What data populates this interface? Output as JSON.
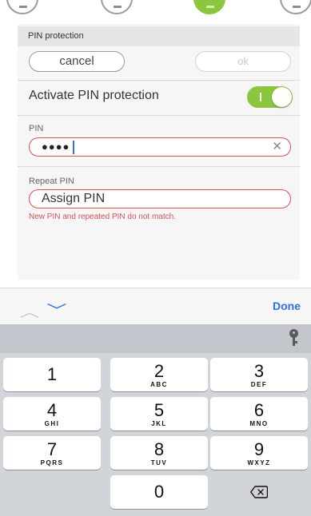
{
  "section": {
    "title": "PIN protection"
  },
  "actions": {
    "cancel_label": "cancel",
    "ok_label": "ok"
  },
  "activate": {
    "label": "Activate PIN protection",
    "enabled": true
  },
  "pin_field": {
    "label": "PIN",
    "masked_value": "●●●●"
  },
  "repeat_field": {
    "label": "Repeat PIN",
    "value": "Assign PIN"
  },
  "error": {
    "message": "New PIN and repeated PIN do not match."
  },
  "accessory": {
    "done_label": "Done"
  },
  "keypad": {
    "keys": [
      {
        "digit": "1",
        "letters": ""
      },
      {
        "digit": "2",
        "letters": "ABC"
      },
      {
        "digit": "3",
        "letters": "DEF"
      },
      {
        "digit": "4",
        "letters": "GHI"
      },
      {
        "digit": "5",
        "letters": "JKL"
      },
      {
        "digit": "6",
        "letters": "MNO"
      },
      {
        "digit": "7",
        "letters": "PQRS"
      },
      {
        "digit": "8",
        "letters": "TUV"
      },
      {
        "digit": "9",
        "letters": "WXYZ"
      },
      {
        "digit": "0",
        "letters": ""
      }
    ]
  },
  "colors": {
    "accent_green": "#8cc63f",
    "error_red": "#d9534f",
    "ios_blue": "#2f6fe6"
  }
}
